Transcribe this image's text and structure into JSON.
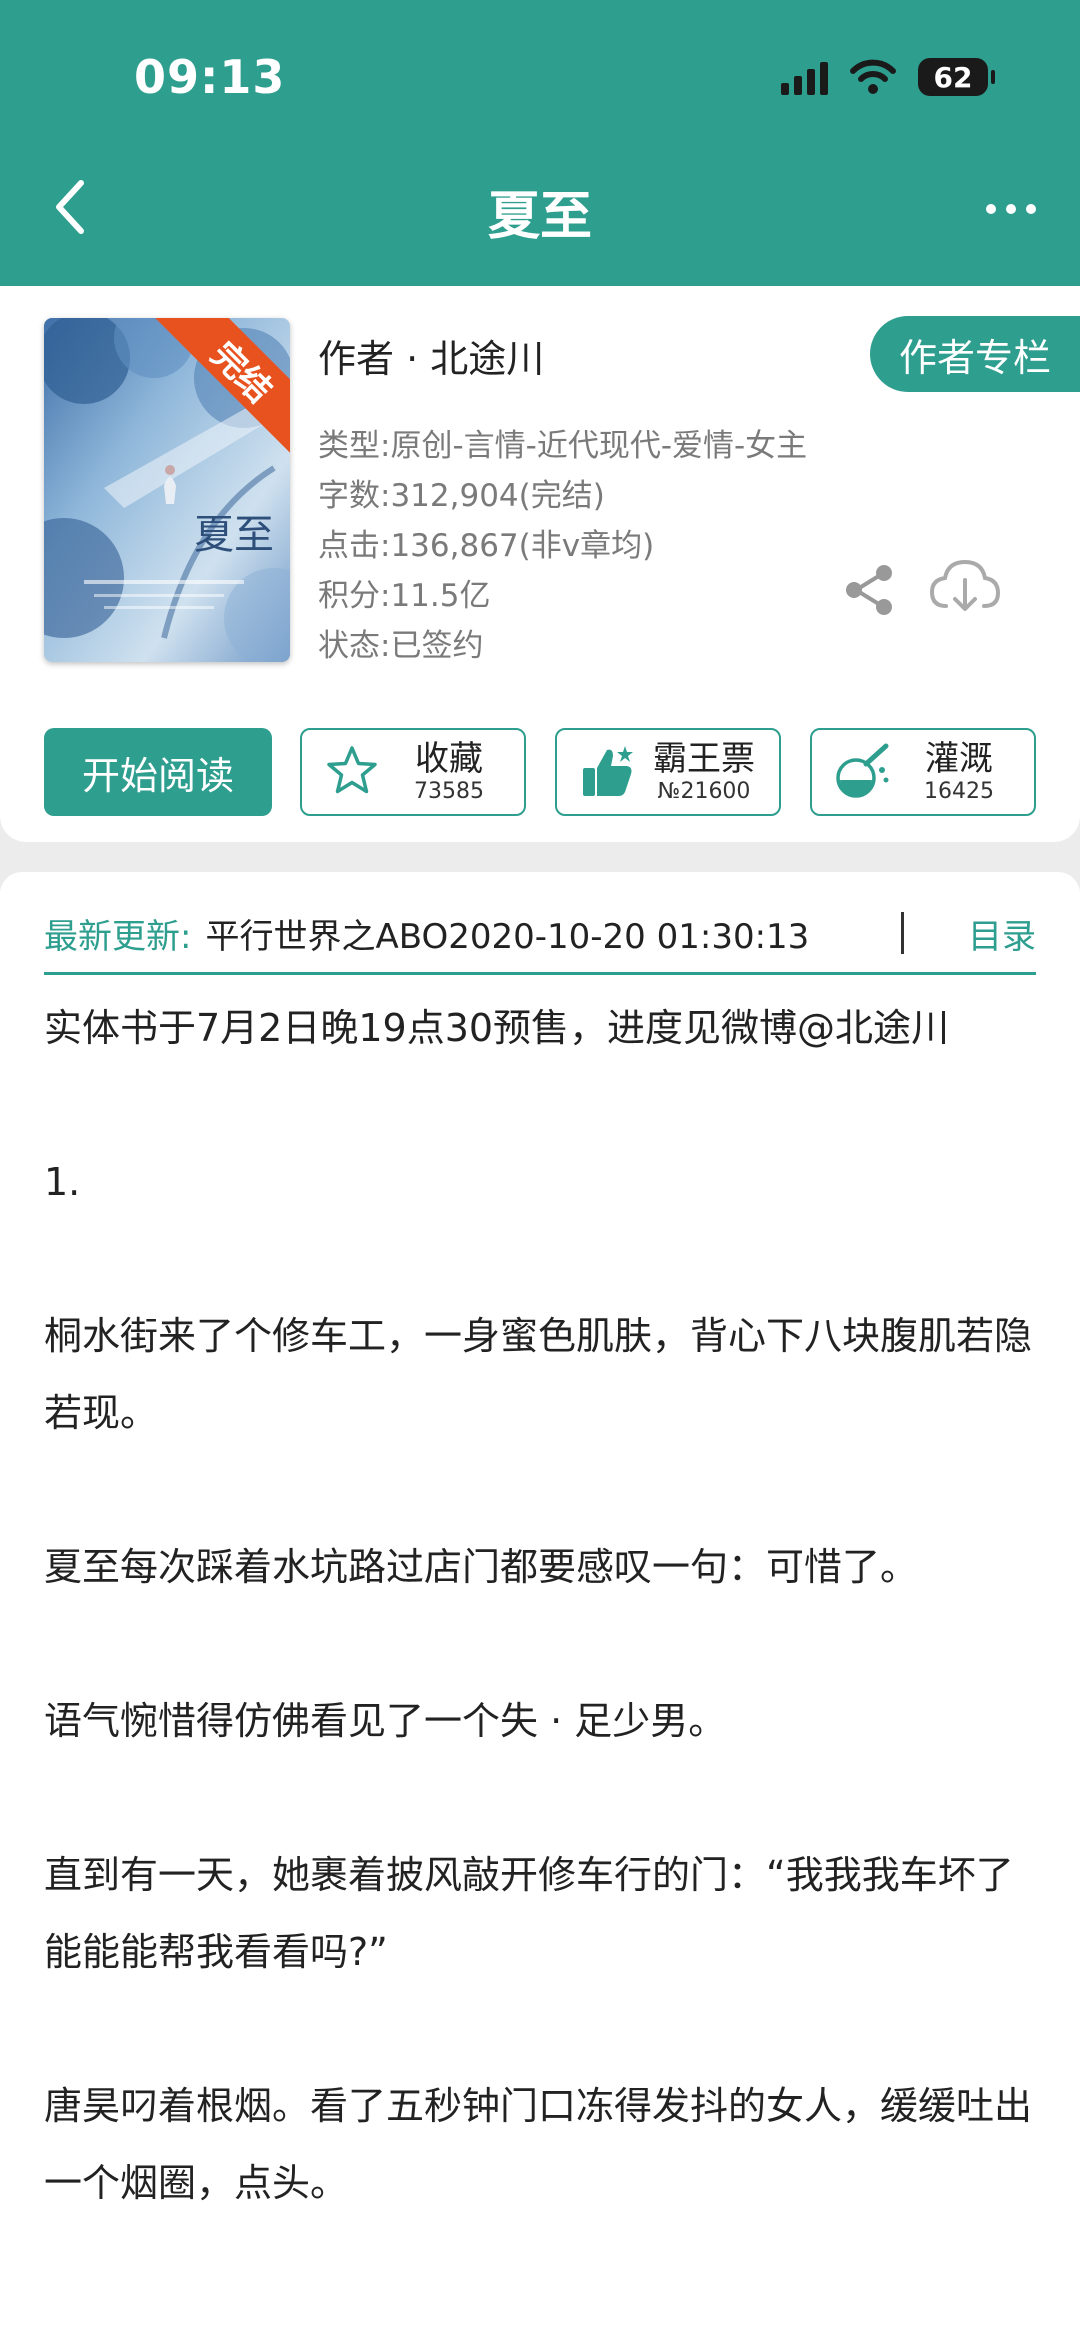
{
  "status_bar": {
    "time": "09:13",
    "battery": "62"
  },
  "nav": {
    "title": "夏至"
  },
  "book": {
    "cover_badge": "完结",
    "cover_title": "夏至",
    "author_line": "作者 · 北途川",
    "author_column_button": "作者专栏",
    "type": "类型:原创-言情-近代现代-爱情-女主",
    "word_count": "字数:312,904(完结)",
    "clicks": "点击:136,867(非v章均)",
    "score": "积分:11.5亿",
    "status": "状态:已签约"
  },
  "actions": {
    "read_label": "开始阅读",
    "collect_label": "收藏",
    "collect_count": "73585",
    "vote_label": "霸王票",
    "vote_count": "№21600",
    "water_label": "灌溉",
    "water_count": "16425"
  },
  "update": {
    "label": "最新更新:",
    "text": "平行世界之ABO2020-10-20 01:30:13",
    "catalog": "目录"
  },
  "paragraphs": [
    "实体书于7月2日晚19点30预售，进度见微博@北途川",
    "1.",
    "桐水街来了个修车工，一身蜜色肌肤，背心下八块腹肌若隐若现。",
    "夏至每次踩着水坑路过店门都要感叹一句：可惜了。",
    "语气惋惜得仿佛看见了一个失 · 足少男。",
    "直到有一天，她裹着披风敲开修车行的门：“我我我车坏了能能能帮我看看吗?”",
    "唐昊叼着根烟。看了五秒钟门口冻得发抖的女人，缓缓吐出一个烟圈，点头。"
  ],
  "colors": {
    "accent": "#2e9e8f",
    "badge": "#e8521f"
  }
}
